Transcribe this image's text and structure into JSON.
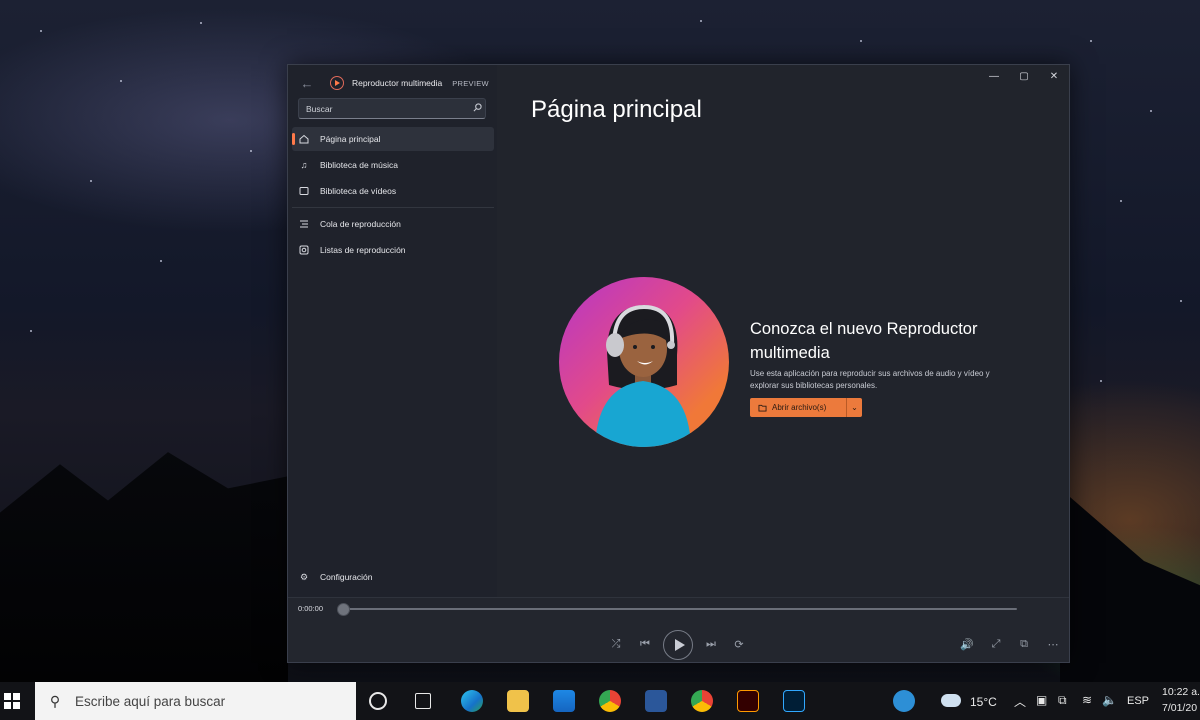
{
  "window": {
    "app_title": "Reproductor multimedia",
    "preview_badge": "PREVIEW",
    "controls": {
      "minimize": "—",
      "maximize": "▢",
      "close": "✕"
    }
  },
  "search": {
    "placeholder": "Buscar"
  },
  "sidebar": {
    "items": [
      {
        "label": "Página principal",
        "icon": "home-icon",
        "active": true
      },
      {
        "label": "Biblioteca de música",
        "icon": "music-note-icon"
      },
      {
        "label": "Biblioteca de vídeos",
        "icon": "video-icon"
      },
      {
        "label": "Cola de reproducción",
        "icon": "queue-icon"
      },
      {
        "label": "Listas de reproducción",
        "icon": "playlist-icon"
      }
    ],
    "settings_label": "Configuración"
  },
  "main": {
    "title": "Página principal",
    "promo_title": "Conozca el nuevo Reproductor multimedia",
    "promo_text": "Use esta aplicación para reproducir sus archivos de audio y vídeo y explorar sus bibliotecas personales.",
    "open_button": "Abrir archivo(s)"
  },
  "player": {
    "time": "0:00:00",
    "progress": 0
  },
  "taskbar": {
    "search_placeholder": "Escribe aquí para buscar",
    "temperature": "15°C",
    "language": "ESP",
    "time": "10:22 a.",
    "date": "7/01/20"
  },
  "colors": {
    "accent": "#ec7a3c",
    "window_bg": "#21242c",
    "sidebar_bg": "#1f222b"
  }
}
